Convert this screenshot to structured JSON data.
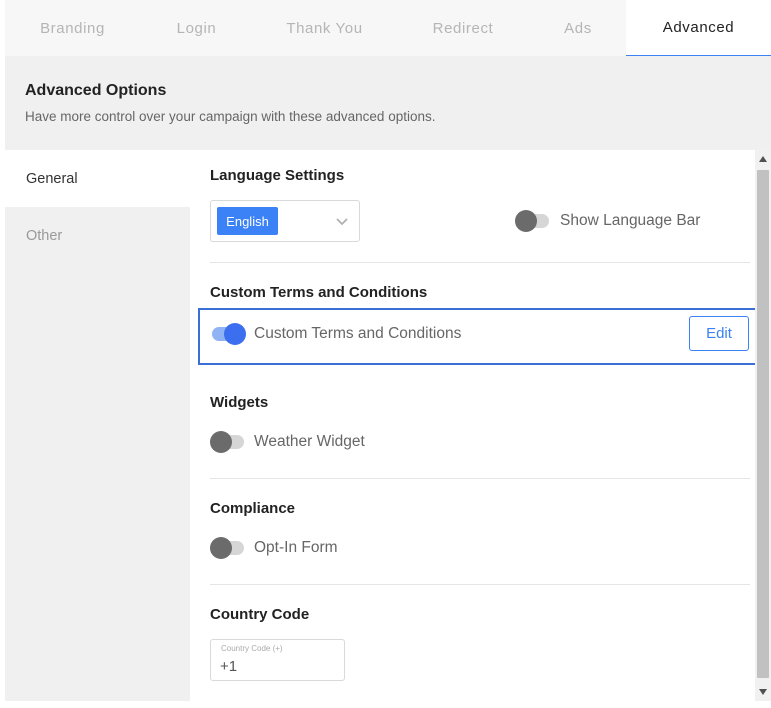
{
  "tabs": [
    {
      "label": "Branding"
    },
    {
      "label": "Login"
    },
    {
      "label": "Thank You"
    },
    {
      "label": "Redirect"
    },
    {
      "label": "Ads"
    },
    {
      "label": "Advanced"
    }
  ],
  "active_tab": "Advanced",
  "header": {
    "title": "Advanced Options",
    "subtitle": "Have more control over your campaign with these advanced options."
  },
  "sidebar": {
    "items": [
      {
        "label": "General"
      },
      {
        "label": "Other"
      }
    ],
    "active": "General"
  },
  "sections": {
    "language": {
      "title": "Language Settings",
      "selected_language": "English",
      "toggle_label": "Show Language Bar",
      "toggle_on": false
    },
    "terms": {
      "title": "Custom Terms and Conditions",
      "toggle_label": "Custom Terms and Conditions",
      "toggle_on": true,
      "edit_label": "Edit"
    },
    "widgets": {
      "title": "Widgets",
      "toggle_label": "Weather Widget",
      "toggle_on": false
    },
    "compliance": {
      "title": "Compliance",
      "toggle_label": "Opt-In Form",
      "toggle_on": false
    },
    "country_code": {
      "title": "Country Code",
      "field_label": "Country Code (+)",
      "value": "+1"
    }
  },
  "colors": {
    "accent": "#3b82f6",
    "toggle_off_knob": "#6b6b6b",
    "highlight_border": "#3b6fd8"
  },
  "icons": {
    "select_caret": "chevron-down-icon",
    "scroll_up": "triangle-up-icon",
    "scroll_down": "triangle-down-icon"
  }
}
